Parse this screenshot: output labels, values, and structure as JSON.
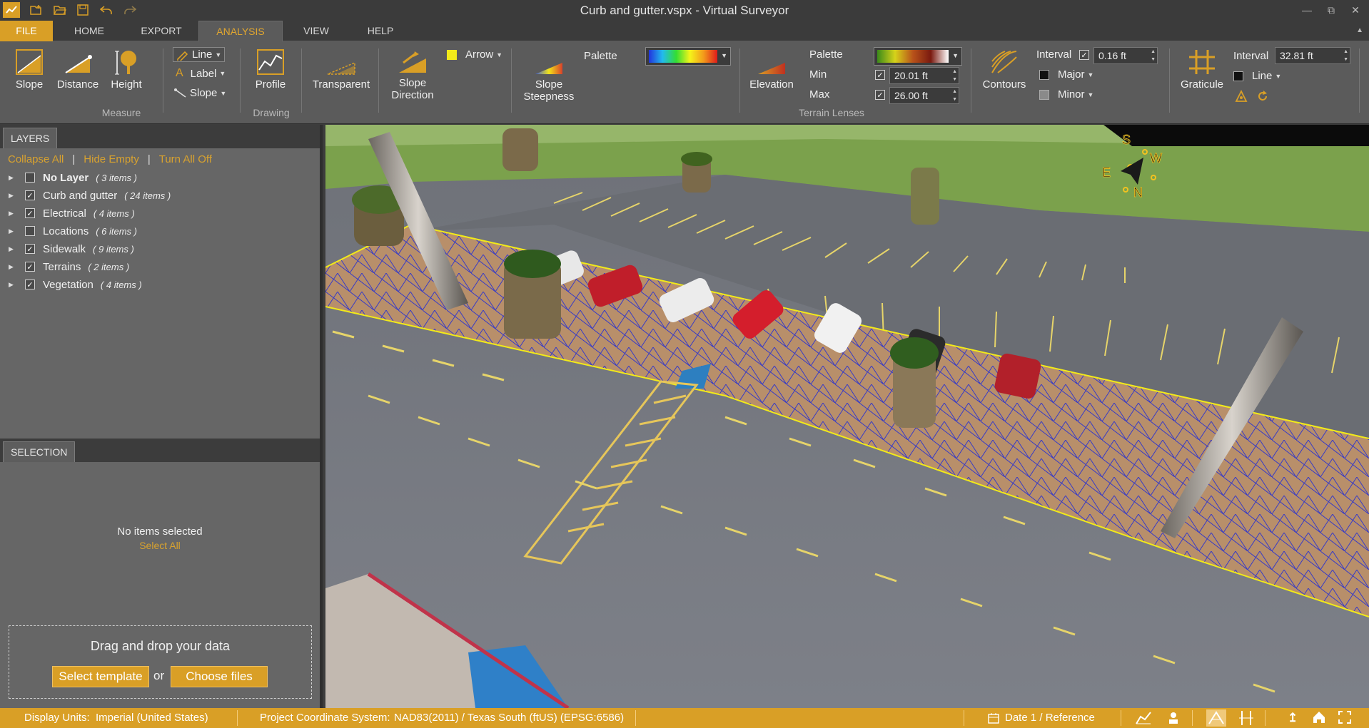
{
  "window": {
    "title": "Curb and gutter.vspx  -  Virtual Surveyor"
  },
  "tabs": [
    {
      "label": "FILE"
    },
    {
      "label": "HOME"
    },
    {
      "label": "EXPORT"
    },
    {
      "label": "ANALYSIS"
    },
    {
      "label": "VIEW"
    },
    {
      "label": "HELP"
    }
  ],
  "ribbon": {
    "measure": {
      "slope": "Slope",
      "distance": "Distance",
      "height": "Height",
      "group": "Measure"
    },
    "drawing": {
      "line": "Line",
      "label": "Label",
      "slope": "Slope",
      "profile": "Profile",
      "group": "Drawing"
    },
    "lenses": {
      "transparent": "Transparent",
      "slope_direction": "Slope Direction",
      "arrow": "Arrow",
      "slope_steepness": "Slope Steepness",
      "palette_label": "Palette",
      "elevation": "Elevation",
      "palette2_label": "Palette",
      "min_label": "Min",
      "min_value": "20.01 ft",
      "max_label": "Max",
      "max_value": "26.00 ft",
      "contours": "Contours",
      "interval_label": "Interval",
      "interval_value": "0.16 ft",
      "major": "Major",
      "minor": "Minor",
      "group": "Terrain Lenses"
    },
    "graticule": {
      "label": "Graticule",
      "interval_label": "Interval",
      "interval_value": "32.81 ft",
      "line": "Line"
    },
    "colors": {
      "arrow": "#f2ea19",
      "major": "#111111",
      "minor": "#8a8a8a",
      "line": "#111111"
    }
  },
  "layers_panel": {
    "tab": "LAYERS",
    "collapse_all": "Collapse All",
    "hide_empty": "Hide Empty",
    "turn_all_off": "Turn All Off",
    "separator": "|",
    "layers": [
      {
        "name": "No Layer",
        "count": "( 3 items )",
        "checked": false,
        "bold": true
      },
      {
        "name": "Curb and gutter",
        "count": "( 24 items )",
        "checked": true,
        "bold": false
      },
      {
        "name": "Electrical",
        "count": "( 4 items )",
        "checked": true,
        "bold": false
      },
      {
        "name": "Locations",
        "count": "( 6 items )",
        "checked": false,
        "bold": false
      },
      {
        "name": "Sidewalk",
        "count": "( 9 items )",
        "checked": true,
        "bold": false
      },
      {
        "name": "Terrains",
        "count": "( 2 items )",
        "checked": true,
        "bold": false
      },
      {
        "name": "Vegetation",
        "count": "( 4 items )",
        "checked": true,
        "bold": false
      }
    ]
  },
  "selection_panel": {
    "tab": "SELECTION",
    "empty_text": "No items selected",
    "select_all": "Select All"
  },
  "drop_panel": {
    "text": "Drag and drop your data",
    "select_template": "Select template",
    "or": "or",
    "choose_files": "Choose files"
  },
  "compass": {
    "s": "S",
    "w": "W",
    "e": "E",
    "n": "N"
  },
  "statusbar": {
    "units_label": "Display Units:",
    "units_value": "Imperial (United States)",
    "crs_label": "Project Coordinate System:",
    "crs_value": "NAD83(2011) / Texas South (ftUS) (EPSG:6586)",
    "date": "Date 1 / Reference"
  },
  "theme": {
    "accent": "#d99f26",
    "accent_text": "#e0a630",
    "link": "#d8a22f",
    "tin": "#1f2bd6",
    "curb": "#f2ea19"
  }
}
